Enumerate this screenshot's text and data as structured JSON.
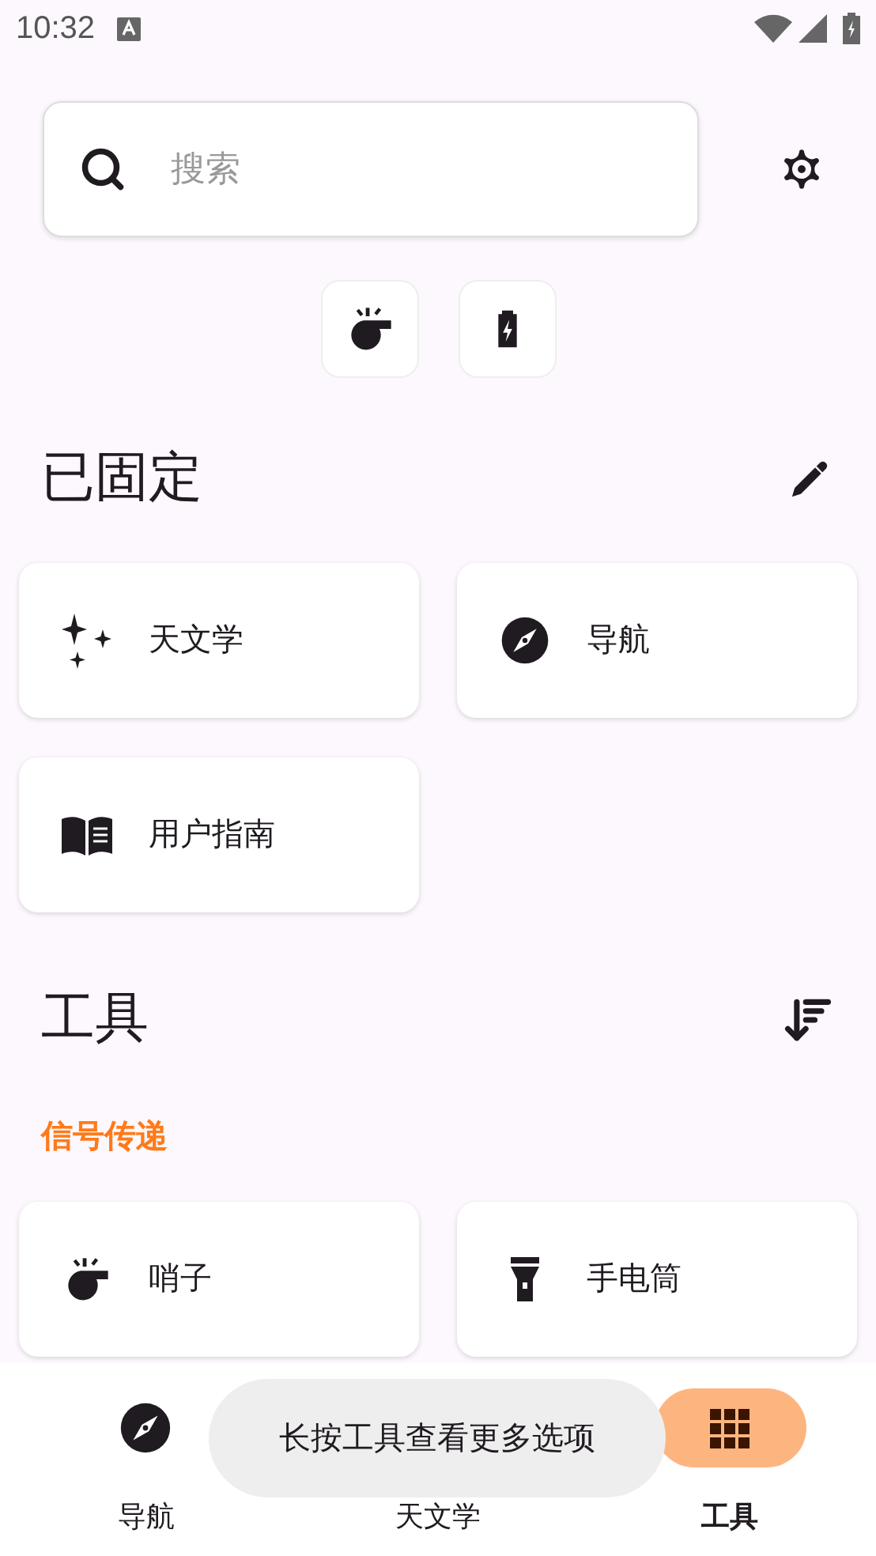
{
  "status_bar": {
    "time": "10:32"
  },
  "search": {
    "placeholder": "搜索"
  },
  "quick_tools": [
    {
      "kind": "whistle"
    },
    {
      "kind": "battery"
    }
  ],
  "pinned": {
    "title": "已固定",
    "items": [
      {
        "kind": "astronomy",
        "label": "天文学"
      },
      {
        "kind": "navigation",
        "label": "导航"
      },
      {
        "kind": "guide",
        "label": "用户指南"
      }
    ]
  },
  "tools": {
    "title": "工具",
    "groups": [
      {
        "title": "信号传递",
        "items": [
          {
            "kind": "whistle",
            "label": "哨子"
          },
          {
            "kind": "flashlight",
            "label": "手电筒"
          }
        ]
      }
    ]
  },
  "bottom_nav": [
    {
      "kind": "navigation",
      "label": "导航",
      "selected": false
    },
    {
      "kind": "astronomy",
      "label": "天文学",
      "selected": false
    },
    {
      "kind": "tools",
      "label": "工具",
      "selected": true
    }
  ],
  "toast": {
    "text": "长按工具查看更多选项"
  }
}
